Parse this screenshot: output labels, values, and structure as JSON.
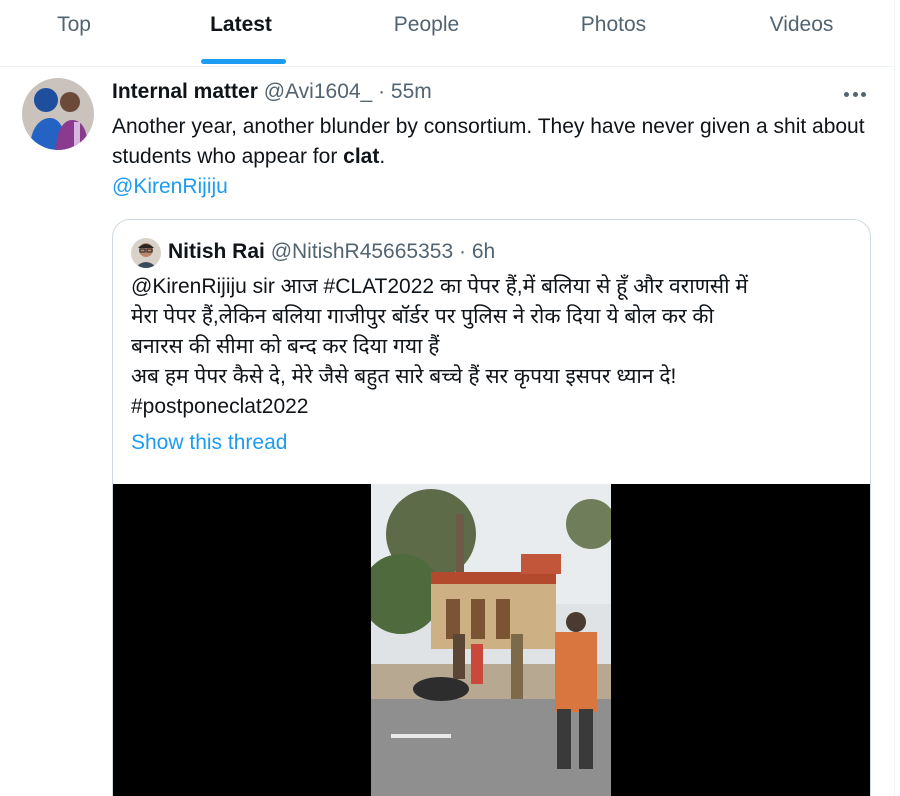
{
  "tabs": [
    {
      "label": "Top",
      "active": false
    },
    {
      "label": "Latest",
      "active": true
    },
    {
      "label": "People",
      "active": false
    },
    {
      "label": "Photos",
      "active": false
    },
    {
      "label": "Videos",
      "active": false
    }
  ],
  "tweet": {
    "author_name": "Internal matter",
    "handle": "@Avi1604_",
    "separator": " · ",
    "time": "55m",
    "text_before": "Another year, another blunder by consortium. They have never given a shit about students who appear for ",
    "text_bold": "clat",
    "text_after": ".",
    "mention": "@KirenRijiju",
    "more_icon": "more-horizontal-icon"
  },
  "quote": {
    "author_name": "Nitish Rai",
    "handle": "@NitishR45665353",
    "separator": " · ",
    "time": "6h",
    "lines": [
      "@KirenRijiju sir आज #CLAT2022 का  पेपर हैं,में बलिया से हूँ और वराणसी में",
      "मेरा पेपर हैं,लेकिन बलिया गाजीपुर बॉर्डर पर पुलिस ने रोक दिया ये बोल कर की",
      "बनारस की सीमा को बन्द कर दिया गया हैं",
      "अब हम पेपर कैसे दे, मेरे जैसे बहुत सारे बच्चे हैं सर कृपया इसपर ध्यान दे!",
      "#postponeclat2022"
    ],
    "show_thread": "Show this thread"
  },
  "colors": {
    "accent": "#1d9bf0",
    "text": "#0f1419",
    "muted": "#536471",
    "border": "#cfd9de"
  }
}
